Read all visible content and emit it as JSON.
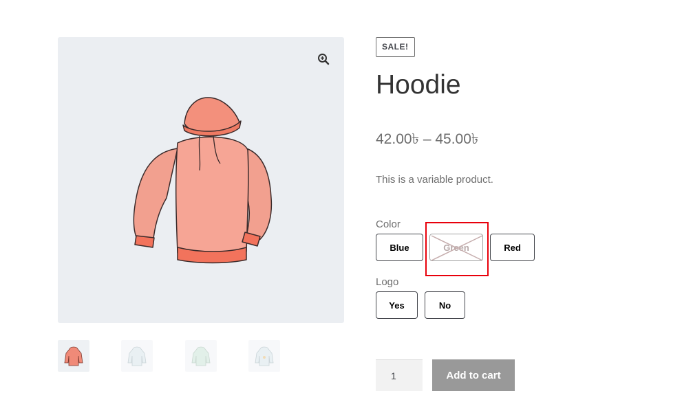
{
  "product": {
    "badge": "SALE!",
    "title": "Hoodie",
    "price_range": "42.00৳ – 45.00৳",
    "description": "This is a variable product."
  },
  "gallery": {
    "zoom_icon": "zoom-in-icon",
    "thumbnails": [
      {
        "name": "hoodie-red",
        "color": "#f08a78"
      },
      {
        "name": "hoodie-blue",
        "color": "#cfe0e6"
      },
      {
        "name": "hoodie-green",
        "color": "#bfe0cf"
      },
      {
        "name": "hoodie-blue-logo",
        "color": "#cfe0e6"
      }
    ]
  },
  "attributes": {
    "color": {
      "label": "Color",
      "options": [
        {
          "label": "Blue",
          "disabled": false
        },
        {
          "label": "Green",
          "disabled": true
        },
        {
          "label": "Red",
          "disabled": false
        }
      ]
    },
    "logo": {
      "label": "Logo",
      "options": [
        {
          "label": "Yes",
          "disabled": false
        },
        {
          "label": "No",
          "disabled": false
        }
      ]
    }
  },
  "cart": {
    "quantity": "1",
    "add_to_cart_label": "Add to cart"
  },
  "colors": {
    "highlight": "#e8000b",
    "hoodie": "#f08a78",
    "button_disabled": "#999999"
  }
}
